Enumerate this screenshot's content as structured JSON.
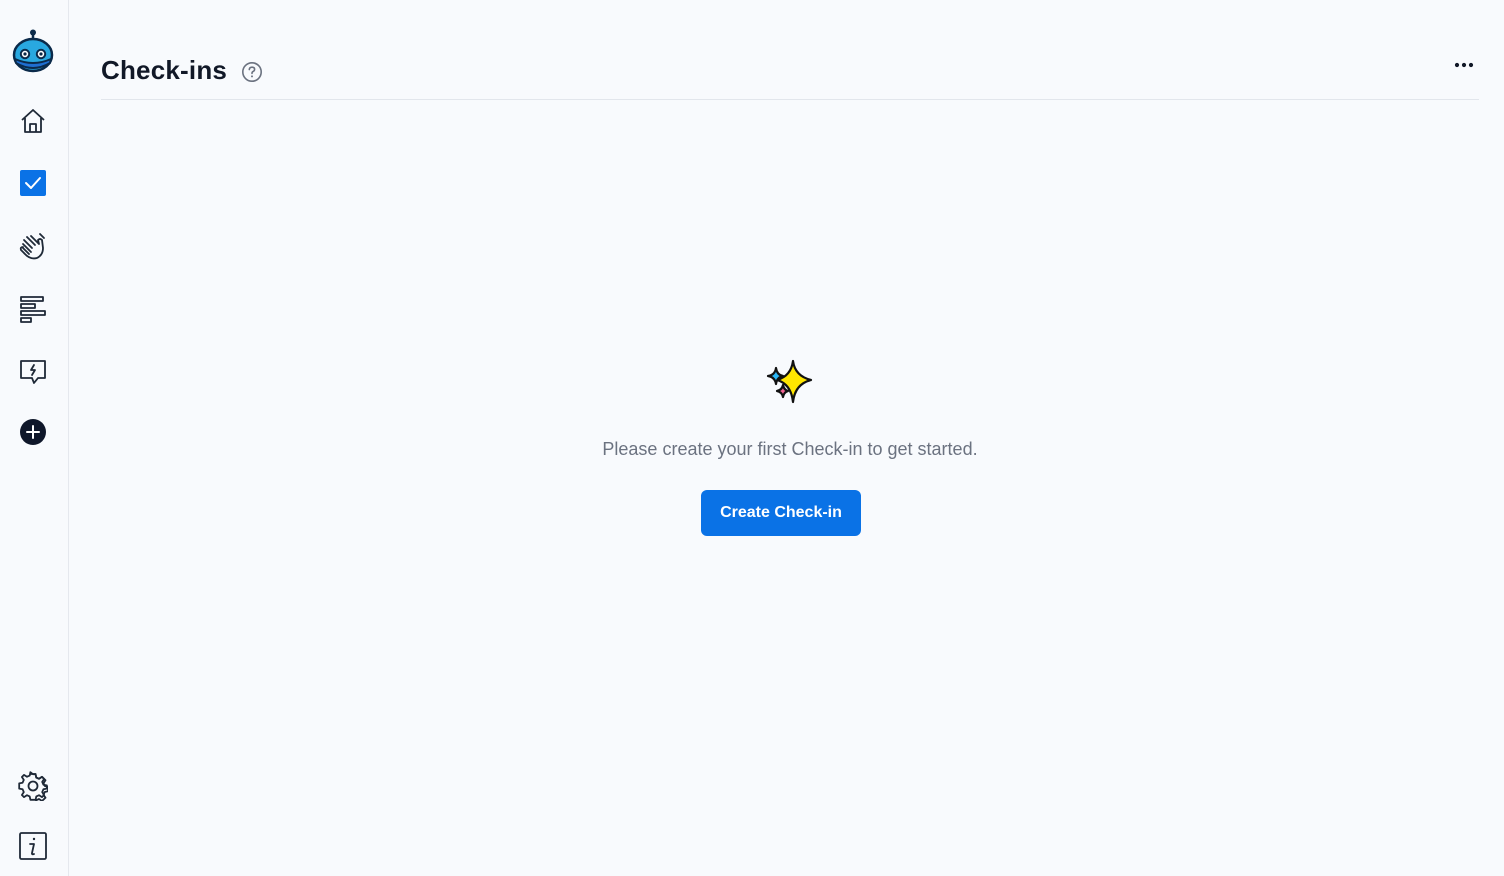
{
  "sidebar": {
    "items": [
      {
        "icon": "robot-logo-icon"
      },
      {
        "icon": "home-icon"
      },
      {
        "icon": "checkbox-icon",
        "active": true
      },
      {
        "icon": "clapping-hands-icon"
      },
      {
        "icon": "align-left-bars-icon"
      },
      {
        "icon": "feedback-message-icon"
      },
      {
        "icon": "add-circle-icon"
      },
      {
        "icon": "settings-gear-icon"
      },
      {
        "icon": "info-icon"
      }
    ]
  },
  "header": {
    "title": "Check-ins",
    "help_icon": "help-circle-icon",
    "more_icon": "more-horizontal-icon"
  },
  "empty_state": {
    "icon": "sparkles-icon",
    "message": "Please create your first Check-in to get started.",
    "button_label": "Create Check-in"
  },
  "colors": {
    "accent": "#0a72e6",
    "background": "#f8fafd",
    "muted_text": "#6b7280",
    "divider": "#e2e6ec"
  }
}
